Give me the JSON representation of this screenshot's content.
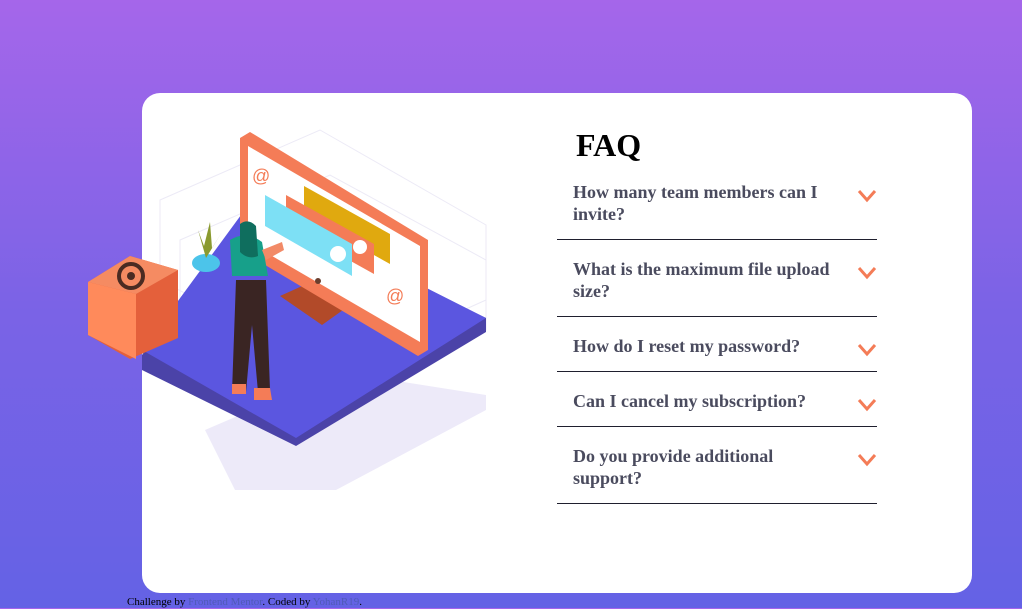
{
  "faq": {
    "title": "FAQ",
    "items": [
      {
        "question": "How many team members can I invite?",
        "expanded": false
      },
      {
        "question": "What is the maximum file upload size?",
        "expanded": false
      },
      {
        "question": "How do I reset my password?",
        "expanded": false
      },
      {
        "question": "Can I cancel my subscription?",
        "expanded": false
      },
      {
        "question": "Do you provide additional support?",
        "expanded": false
      }
    ],
    "chevron_icon": "chevron-down-icon"
  },
  "illustration": {
    "icons": [
      "at-sign-icon",
      "plant-icon",
      "woman-figure",
      "monitor"
    ]
  },
  "footer": {
    "prefix": "Challenge by ",
    "link1": "Frontend Mentor",
    "middle": ". Coded by ",
    "link2": "YohanR19",
    "suffix": "."
  },
  "colors": {
    "background_top": "#a566ea",
    "background_bottom": "#6462e5",
    "card": "#ffffff",
    "question_text": "#4a4b5e",
    "chevron": "#f47c57",
    "link": "#4f5ab7"
  }
}
